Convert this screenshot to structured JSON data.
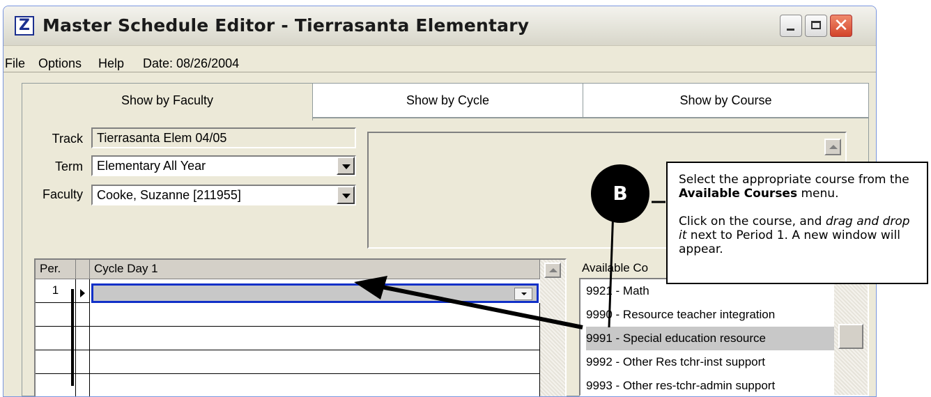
{
  "window": {
    "title": "Master Schedule Editor - Tierrasanta Elementary",
    "app_icon": "Z"
  },
  "menu": {
    "file": "File",
    "options": "Options",
    "help": "Help",
    "date": "Date: 08/26/2004"
  },
  "tabs": [
    {
      "label": "Show by Faculty",
      "active": true
    },
    {
      "label": "Show by Cycle"
    },
    {
      "label": "Show by Course"
    }
  ],
  "form": {
    "track_label": "Track",
    "track_value": "Tierrasanta Elem 04/05",
    "term_label": "Term",
    "term_value": "Elementary All Year",
    "faculty_label": "Faculty",
    "faculty_value": "Cooke, Suzanne [211955]"
  },
  "grid": {
    "col_period": "Per.",
    "col_cycle": "Cycle Day 1",
    "rows": [
      "1",
      "",
      "",
      "",
      ""
    ]
  },
  "available": {
    "label": "Available Courses",
    "label_visible": "Available Co",
    "courses": [
      "9921 - Math",
      "9990 - Resource teacher integration",
      "9991 - Special education resource",
      "9992 - Other Res tchr-inst support",
      "9993 - Other res-tchr-admin support"
    ],
    "selected_index": 2
  },
  "callout": {
    "badge": "B",
    "line1_pre": "Select the appropriate course from the ",
    "line1_bold": "Available Courses",
    "line1_post": " menu.",
    "line2_pre": "Click on the course, and ",
    "line2_em": "drag and drop it",
    "line2_post": " next to Period 1. A new window will appear."
  },
  "colors": {
    "selection_border": "#1030c8",
    "title_close": "#d3442a"
  }
}
